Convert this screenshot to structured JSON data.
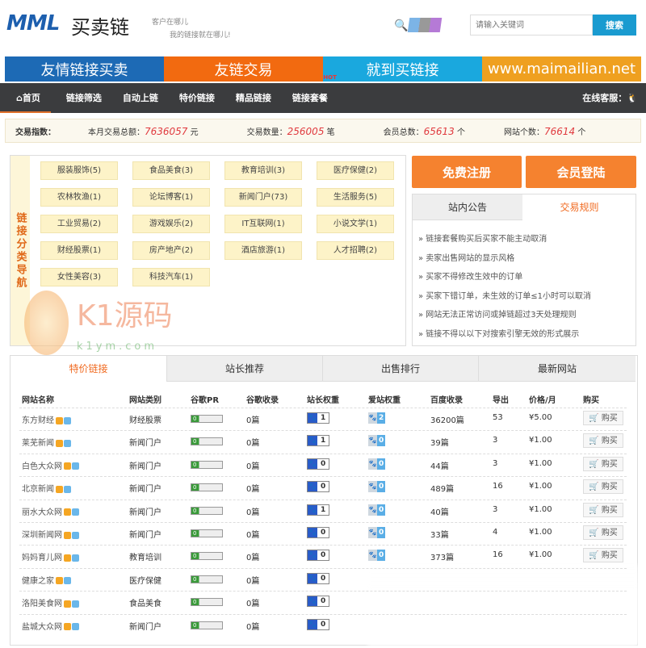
{
  "header": {
    "logo": "MML",
    "logo_cn": "买卖链",
    "slogan_line1": "客户在哪儿",
    "slogan_line2": "我的链接就在哪儿!",
    "search_placeholder": "请输入关键词",
    "search_button": "搜索"
  },
  "banner": [
    {
      "text": "友情链接买卖",
      "color": "#1d6ab5"
    },
    {
      "text": "友链交易",
      "color": "#f26a10"
    },
    {
      "text": "就到买链接",
      "color": "#1aa8de"
    },
    {
      "text": "www.maimailian.net",
      "color": "#efa020"
    }
  ],
  "nav": {
    "items": [
      "首页",
      "链接筛选",
      "自动上链",
      "特价链接",
      "精品链接",
      "链接套餐"
    ],
    "hot_badge": "HOT",
    "service": "在线客服："
  },
  "stats": {
    "label": "交易指数：",
    "total_label": "本月交易总额：",
    "total": "7636057",
    "total_unit": "元",
    "count_label": "交易数量：",
    "count": "256005",
    "count_unit": "笔",
    "members_label": "会员总数：",
    "members": "65613",
    "members_unit": "个",
    "sites_label": "网站个数：",
    "sites": "76614",
    "sites_unit": "个"
  },
  "categories": {
    "title": "链接分类导航",
    "items": [
      "服装服饰(5)",
      "食品美食(3)",
      "教育培训(3)",
      "医疗保健(2)",
      "农林牧渔(1)",
      "论坛博客(1)",
      "新闻门户(73)",
      "生活服务(5)",
      "工业贸易(2)",
      "游戏娱乐(2)",
      "IT互联网(1)",
      "小说文学(1)",
      "财经股票(1)",
      "房产地产(2)",
      "酒店旅游(1)",
      "人才招聘(2)",
      "女性美容(3)",
      "科技汽车(1)"
    ]
  },
  "watermark": {
    "text": "K1源码",
    "url": "k1ym.com"
  },
  "actions": {
    "register": "免费注册",
    "login": "会员登陆"
  },
  "notice": {
    "tabs": [
      "站内公告",
      "交易规则"
    ],
    "rules": [
      "» 链接套餐购买后买家不能主动取消",
      "» 卖家出售网站的显示风格",
      "» 买家不得修改生效中的订单",
      "» 买家下错订单，未生效的订单≤1小时可以取消",
      "» 网站无法正常访问或掉链超过3天处理规则",
      "» 链接不得以以下对搜索引擎无效的形式展示"
    ]
  },
  "table": {
    "tabs": [
      "特价链接",
      "站长推荐",
      "出售排行",
      "最新网站"
    ],
    "headers": [
      "网站名称",
      "网站类别",
      "谷歌PR",
      "谷歌收录",
      "站长权重",
      "爱站权重",
      "百度收录",
      "导出",
      "价格/月",
      "购买"
    ],
    "buy_label": "购买",
    "rows": [
      {
        "name": "东方财经",
        "cat": "财经股票",
        "pr": "0",
        "google": "0篇",
        "zz": "1",
        "az": "2",
        "baidu": "36200篇",
        "out": "53",
        "price": "¥5.00"
      },
      {
        "name": "莱芜新闻",
        "cat": "新闻门户",
        "pr": "0",
        "google": "0篇",
        "zz": "1",
        "az": "0",
        "baidu": "39篇",
        "out": "3",
        "price": "¥1.00"
      },
      {
        "name": "白色大众网",
        "cat": "新闻门户",
        "pr": "0",
        "google": "0篇",
        "zz": "0",
        "az": "0",
        "baidu": "44篇",
        "out": "3",
        "price": "¥1.00"
      },
      {
        "name": "北京新闻",
        "cat": "新闻门户",
        "pr": "0",
        "google": "0篇",
        "zz": "0",
        "az": "0",
        "baidu": "489篇",
        "out": "16",
        "price": "¥1.00"
      },
      {
        "name": "丽水大众网",
        "cat": "新闻门户",
        "pr": "0",
        "google": "0篇",
        "zz": "1",
        "az": "0",
        "baidu": "40篇",
        "out": "3",
        "price": "¥1.00"
      },
      {
        "name": "深圳新闻网",
        "cat": "新闻门户",
        "pr": "0",
        "google": "0篇",
        "zz": "0",
        "az": "0",
        "baidu": "33篇",
        "out": "4",
        "price": "¥1.00"
      },
      {
        "name": "妈妈育儿网",
        "cat": "教育培训",
        "pr": "0",
        "google": "0篇",
        "zz": "0",
        "az": "0",
        "baidu": "373篇",
        "out": "16",
        "price": "¥1.00"
      },
      {
        "name": "健康之家",
        "cat": "医疗保健",
        "pr": "0",
        "google": "0篇",
        "zz": "0"
      },
      {
        "name": "洛阳美食网",
        "cat": "食品美食",
        "pr": "0",
        "google": "0篇",
        "zz": "0"
      },
      {
        "name": "盐城大众网",
        "cat": "新闻门户",
        "pr": "0",
        "google": "0篇",
        "zz": "0"
      }
    ]
  }
}
